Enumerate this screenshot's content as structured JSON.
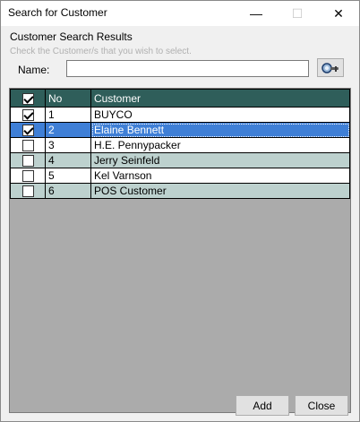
{
  "window": {
    "title": "Search for Customer",
    "minimize_glyph": "—",
    "maximize_glyph": "☐",
    "close_glyph": "✕"
  },
  "section": {
    "title": "Customer Search Results",
    "hint": "Check the Customer/s that you wish to select."
  },
  "search": {
    "label": "Name:",
    "value": "",
    "placeholder": "",
    "button_icon": "search-binoculars-icon"
  },
  "grid": {
    "columns": [
      "No",
      "Customer"
    ],
    "header_checked": true,
    "rows": [
      {
        "checked": true,
        "no": "1",
        "customer": "BUYCO",
        "style": "white"
      },
      {
        "checked": true,
        "no": "2",
        "customer": "Elaine Bennett",
        "style": "selected"
      },
      {
        "checked": false,
        "no": "3",
        "customer": "H.E. Pennypacker",
        "style": "white"
      },
      {
        "checked": false,
        "no": "4",
        "customer": "Jerry Seinfeld",
        "style": "alt"
      },
      {
        "checked": false,
        "no": "5",
        "customer": "Kel Varnson",
        "style": "white"
      },
      {
        "checked": false,
        "no": "6",
        "customer": "POS Customer",
        "style": "alt"
      }
    ]
  },
  "buttons": {
    "add": "Add",
    "close": "Close"
  },
  "colors": {
    "header": "#2f5e5a",
    "alt_row": "#bdd1ce",
    "selected_row": "#3f7fd6"
  }
}
